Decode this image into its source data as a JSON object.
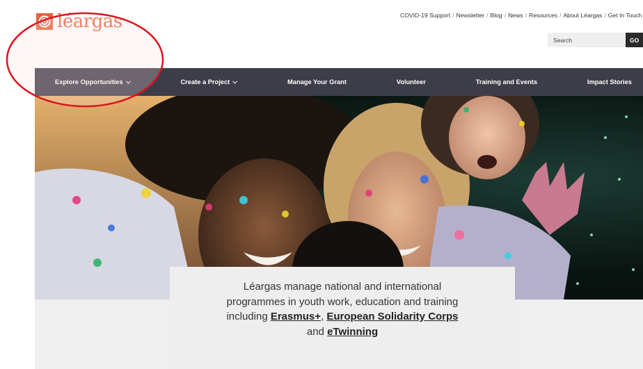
{
  "logo": {
    "text": "léargas",
    "icon": "swirl-logo-icon"
  },
  "utility_nav": {
    "items": [
      "COVID-19 Support",
      "Newsletter",
      "Blog",
      "News",
      "Resources",
      "About Léargas",
      "Get In Touch"
    ],
    "separator": "/"
  },
  "search": {
    "placeholder": "Search",
    "button_label": "GO"
  },
  "main_nav": {
    "items": [
      {
        "label": "Explore Opportunities",
        "has_dropdown": true
      },
      {
        "label": "Create a Project",
        "has_dropdown": true
      },
      {
        "label": "Manage Your Grant",
        "has_dropdown": false
      },
      {
        "label": "Volunteer",
        "has_dropdown": false
      },
      {
        "label": "Training and Events",
        "has_dropdown": false
      },
      {
        "label": "Impact Stories",
        "has_dropdown": false
      }
    ]
  },
  "hero": {
    "image": "young-people-laughing-covered-in-colour-powder"
  },
  "intro": {
    "line1": "Léargas manage national and international",
    "line2": "programmes in youth work, education and training",
    "line3_prefix": "including ",
    "link_erasmus": "Erasmus+",
    "comma": ", ",
    "link_esc": "European Solidarity Corps",
    "line4_prefix": "and ",
    "link_etwinning": "eTwinning"
  },
  "colors": {
    "brand_orange": "#e8623a",
    "nav_background": "#3d3d4a",
    "annotation_red": "#d9141e",
    "card_background": "#efeeee"
  }
}
